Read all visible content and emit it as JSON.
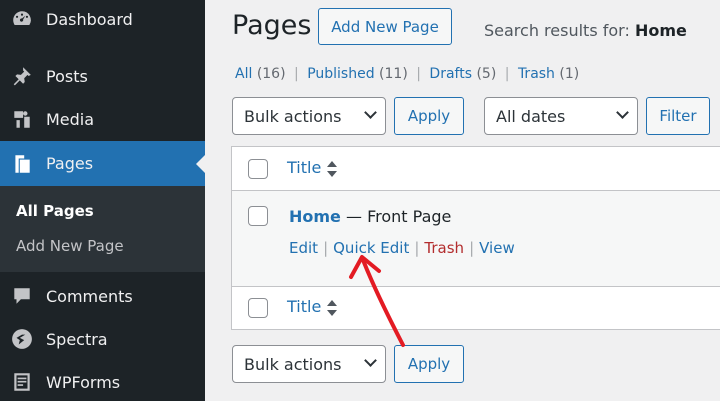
{
  "sidebar": {
    "items": [
      {
        "label": "Dashboard",
        "icon": "dashboard-icon"
      },
      {
        "label": "Posts",
        "icon": "pushpin-icon"
      },
      {
        "label": "Media",
        "icon": "media-icon"
      },
      {
        "label": "Pages",
        "icon": "pages-icon"
      },
      {
        "label": "Comments",
        "icon": "comment-icon"
      },
      {
        "label": "Spectra",
        "icon": "spectra-icon"
      },
      {
        "label": "WPForms",
        "icon": "wpforms-icon"
      }
    ],
    "submenu": [
      "All Pages",
      "Add New Page"
    ]
  },
  "header": {
    "title": "Pages",
    "add_new": "Add New Page",
    "search_prefix": "Search results for: ",
    "search_term": "Home"
  },
  "filters": {
    "all": "All",
    "all_count": "(16)",
    "published": "Published",
    "published_count": "(11)",
    "drafts": "Drafts",
    "drafts_count": "(5)",
    "trash": "Trash",
    "trash_count": "(1)"
  },
  "controls": {
    "bulk_actions": "Bulk actions",
    "apply": "Apply",
    "all_dates": "All dates",
    "filter": "Filter"
  },
  "table": {
    "column_title": "Title",
    "rows": [
      {
        "title": "Home",
        "state": " — Front Page",
        "actions": [
          "Edit",
          "Quick Edit",
          "Trash",
          "View"
        ]
      }
    ]
  },
  "colors": {
    "accent": "#2271b1",
    "sidebar": "#1d2327",
    "trash": "#b32d2e",
    "annotation": "#e31b23"
  }
}
